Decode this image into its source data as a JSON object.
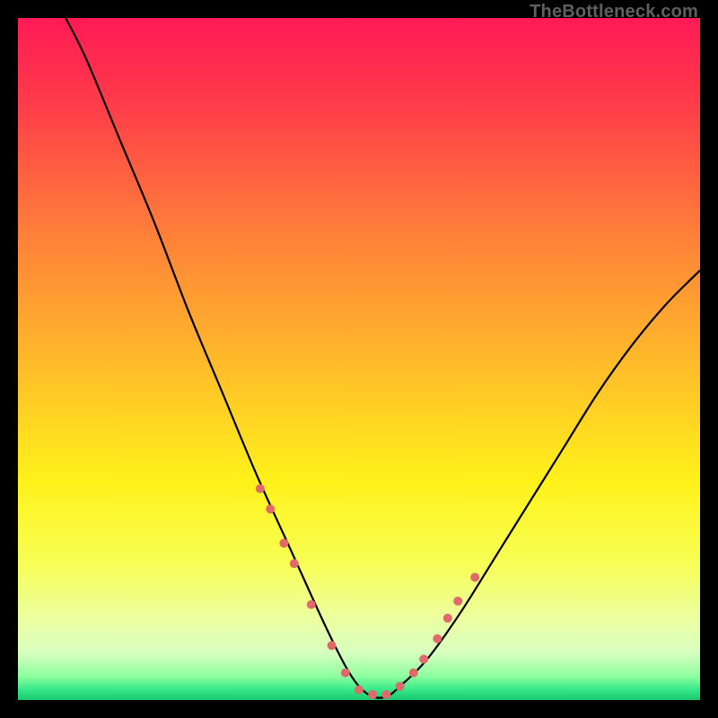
{
  "watermark": "TheBottleneck.com",
  "chart_data": {
    "type": "line",
    "title": "",
    "xlabel": "",
    "ylabel": "",
    "xlim": [
      0,
      100
    ],
    "ylim": [
      0,
      100
    ],
    "grid": false,
    "legend": false,
    "curve": {
      "name": "bottleneck-curve",
      "color": "#000000",
      "x": [
        7,
        10,
        15,
        20,
        25,
        30,
        35,
        40,
        45,
        48,
        50,
        52,
        54,
        56,
        60,
        65,
        70,
        75,
        80,
        85,
        90,
        95,
        100
      ],
      "y": [
        100,
        94,
        82,
        70,
        57,
        45,
        33,
        22,
        11,
        5,
        2,
        0.5,
        0.5,
        2,
        6,
        13,
        21,
        29,
        37,
        45,
        52,
        58,
        63
      ]
    },
    "markers": {
      "name": "highlight-points",
      "color": "#e06a6a",
      "radius": 5,
      "x": [
        35.5,
        37,
        39,
        40.5,
        43,
        46,
        48,
        50,
        52,
        54,
        56,
        58,
        59.5,
        61.5,
        63,
        64.5,
        67
      ],
      "y": [
        31,
        28,
        23,
        20,
        14,
        8,
        4,
        1.5,
        0.8,
        0.8,
        2,
        4,
        6,
        9,
        12,
        14.5,
        18
      ]
    },
    "background_gradient": {
      "stops": [
        {
          "offset": 0.0,
          "color": "#ff1a55"
        },
        {
          "offset": 0.12,
          "color": "#ff3a4a"
        },
        {
          "offset": 0.3,
          "color": "#ff7a3a"
        },
        {
          "offset": 0.5,
          "color": "#ffb92a"
        },
        {
          "offset": 0.68,
          "color": "#fff21a"
        },
        {
          "offset": 0.8,
          "color": "#f7ff55"
        },
        {
          "offset": 0.88,
          "color": "#ecffa0"
        },
        {
          "offset": 0.93,
          "color": "#d8ffc0"
        },
        {
          "offset": 0.965,
          "color": "#8effa0"
        },
        {
          "offset": 0.985,
          "color": "#35e887"
        },
        {
          "offset": 1.0,
          "color": "#18c96f"
        }
      ]
    }
  }
}
